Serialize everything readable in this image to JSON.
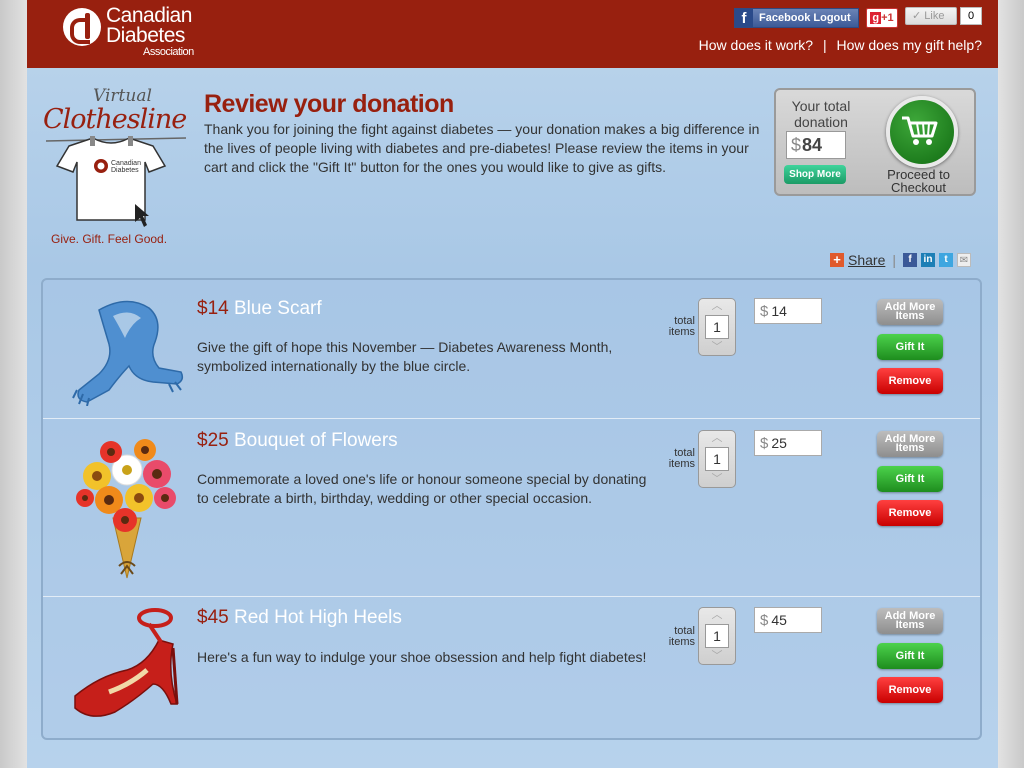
{
  "header": {
    "org_name_line1": "Canadian",
    "org_name_line2": "Diabetes",
    "org_name_line3": "Association",
    "facebook_logout": "Facebook Logout",
    "gplus": "+1",
    "like_label": "Like",
    "like_count": "0",
    "link_how_it_works": "How does it work?",
    "link_separator": "|",
    "link_gift_help": "How does my gift help?",
    "brand_color": "#98200f"
  },
  "clothesline": {
    "virtual": "Virtual",
    "title": "Clothesline",
    "shirt_org_line1": "Canadian",
    "shirt_org_line2": "Diabetes",
    "tagline": "Give. Gift. Feel Good."
  },
  "review": {
    "title": "Review your donation",
    "text": "Thank you for joining the fight against diabetes — your donation makes a big difference in the lives of people living with diabetes and pre-diabetes! Please review the items in your cart and click the \"Gift It\" button for the ones you would like to give as gifts."
  },
  "total": {
    "label": "Your total donation",
    "currency": "$",
    "amount": "84",
    "shop_more": "Shop More",
    "proceed": "Proceed to Checkout"
  },
  "share": {
    "label": "Share",
    "separator": "|"
  },
  "items_common": {
    "total_items_label": "total items",
    "currency": "$",
    "add_more": "Add More Items",
    "gift_it": "Gift It",
    "remove": "Remove"
  },
  "items": [
    {
      "price": "$14",
      "name": "Blue Scarf",
      "description": "Give the gift of hope this November — Diabetes Awareness Month, symbolized internationally by the blue circle.",
      "qty": "1",
      "amount": "14"
    },
    {
      "price": "$25",
      "name": "Bouquet of Flowers",
      "description": "Commemorate a loved one's life or honour someone special by donating to celebrate a birth, birthday, wedding or other special occasion.",
      "qty": "1",
      "amount": "25"
    },
    {
      "price": "$45",
      "name": "Red Hot High Heels",
      "description": "Here's a fun way to indulge your shoe obsession and help fight diabetes!",
      "qty": "1",
      "amount": "45"
    }
  ]
}
